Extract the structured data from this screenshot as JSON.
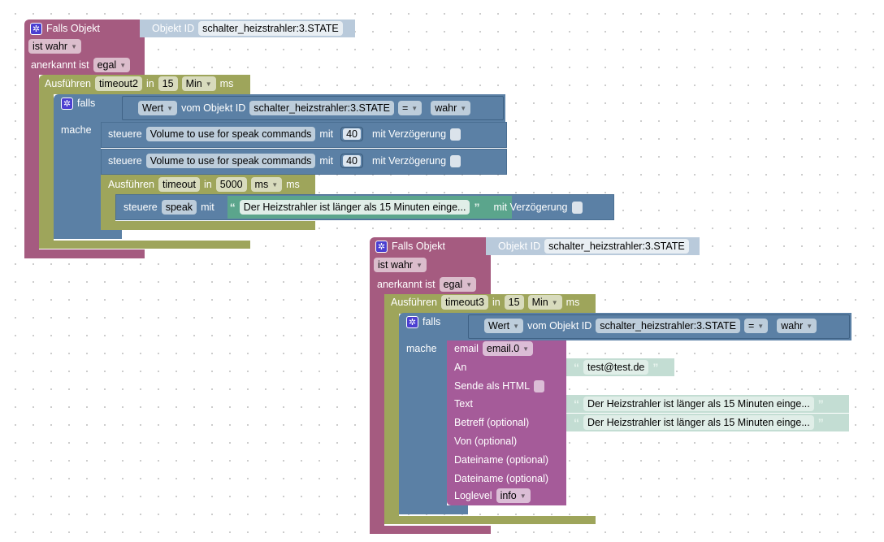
{
  "block1": {
    "header": "Falls Objekt",
    "objekt_id_label": "Objekt ID",
    "objekt_id": "schalter_heizstrahler:3.STATE",
    "ist": "ist wahr",
    "anerkannt_label": "anerkannt ist",
    "anerkannt": "egal",
    "timer": {
      "label": "Ausführen",
      "name": "timeout2",
      "in": "in",
      "value": "15",
      "unit": "Min",
      "suffix": "ms"
    },
    "if": {
      "label": "falls",
      "do": "mache",
      "wert": "Wert",
      "vom": "vom Objekt ID",
      "id": "schalter_heizstrahler:3.STATE",
      "op": "=",
      "val": "wahr"
    },
    "control1": {
      "label": "steuere",
      "target": "Volume to use for speak commands",
      "mit": "mit",
      "value": "40",
      "delay": "mit Verzögerung"
    },
    "control2": {
      "label": "steuere",
      "target": "Volume to use for speak commands",
      "mit": "mit",
      "value": "40",
      "delay": "mit Verzögerung"
    },
    "timer2": {
      "label": "Ausführen",
      "name": "timeout",
      "in": "in",
      "value": "5000",
      "unit": "ms",
      "suffix": "ms"
    },
    "control3": {
      "label": "steuere",
      "target": "speak",
      "mit": "mit",
      "text": "Der Heizstrahler ist länger als 15 Minuten einge...",
      "delay": "mit Verzögerung"
    }
  },
  "block2": {
    "header": "Falls Objekt",
    "objekt_id_label": "Objekt ID",
    "objekt_id": "schalter_heizstrahler:3.STATE",
    "ist": "ist wahr",
    "anerkannt_label": "anerkannt ist",
    "anerkannt": "egal",
    "timer": {
      "label": "Ausführen",
      "name": "timeout3",
      "in": "in",
      "value": "15",
      "unit": "Min",
      "suffix": "ms"
    },
    "if": {
      "label": "falls",
      "do": "mache",
      "wert": "Wert",
      "vom": "vom Objekt ID",
      "id": "schalter_heizstrahler:3.STATE",
      "op": "=",
      "val": "wahr"
    },
    "email": {
      "label": "email",
      "instance": "email.0",
      "to_label": "An",
      "to": "test@test.de",
      "html_label": "Sende als HTML",
      "text_label": "Text",
      "text": "Der Heizstrahler ist länger als 15 Minuten einge...",
      "subject_label": "Betreff (optional)",
      "subject": "Der Heizstrahler ist länger als 15 Minuten einge...",
      "from_label": "Von (optional)",
      "file1_label": "Dateiname (optional)",
      "file2_label": "Dateiname (optional)",
      "loglevel_label": "Loglevel",
      "loglevel": "info"
    }
  },
  "colors": {
    "trigger": "#a55b80",
    "timer": "#9ea55b",
    "logic": "#5b80a5",
    "email": "#a55b99",
    "text": "#5ba58c"
  }
}
